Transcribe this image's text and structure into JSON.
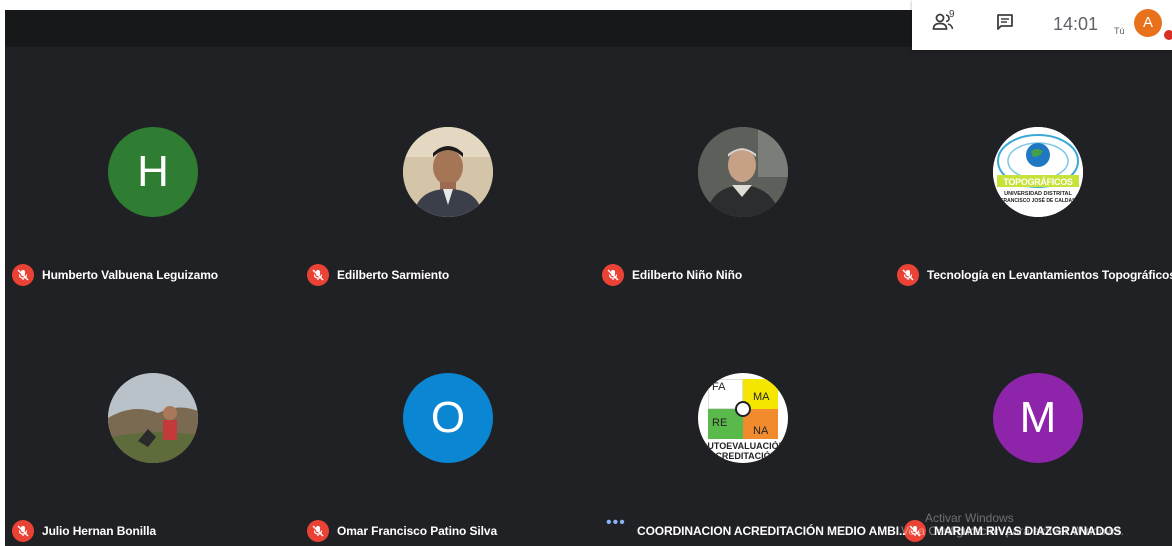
{
  "topbar": {
    "participants_count": "9",
    "time": "14:01",
    "self_label": "Tú",
    "self_initial": "A",
    "people_icon": "people-icon",
    "chat_icon": "chat-icon"
  },
  "participants": [
    {
      "name": "Humberto Valbuena Leguizamo",
      "initial": "H",
      "avatar_color": "#2e7d32",
      "muted": true
    },
    {
      "name": "Edilberto Sarmiento",
      "avatar": "photo",
      "muted": true
    },
    {
      "name": "Edilberto Niño Niño",
      "avatar": "photo",
      "muted": true
    },
    {
      "name": "Tecnología en Levantamientos Topográficos U",
      "avatar": "logo",
      "logo_text": [
        "TOPOGRÁFICOS",
        "UNIVERSIDAD DISTRITAL",
        "FRANCISCO JOSÉ DE CALDAS"
      ],
      "muted": true
    },
    {
      "name": "Julio Hernan Bonilla",
      "avatar": "photo",
      "muted": true
    },
    {
      "name": "Omar Francisco Patino Silva",
      "initial": "O",
      "avatar_color": "#0b86d3",
      "muted": true
    },
    {
      "name": "COORDINACION ACREDITACIÓN MEDIO AMBI...",
      "avatar": "logo",
      "logo_text": [
        "FA",
        "MA",
        "RE",
        "NA",
        "AUTOEVALUACIÓN",
        "ACREDITACIÓN"
      ],
      "muted": false
    },
    {
      "name": "MARIAM RIVAS DIAZGRANADOS",
      "initial": "M",
      "avatar_color": "#8e24aa",
      "muted": true
    }
  ],
  "overlay": {
    "activate_title": "Activar Windows",
    "activate_text": "Ve a Configuración para activar Windows."
  },
  "colors": {
    "background": "#202124",
    "mic_muted": "#ea4335",
    "self_avatar": "#e8711c"
  }
}
